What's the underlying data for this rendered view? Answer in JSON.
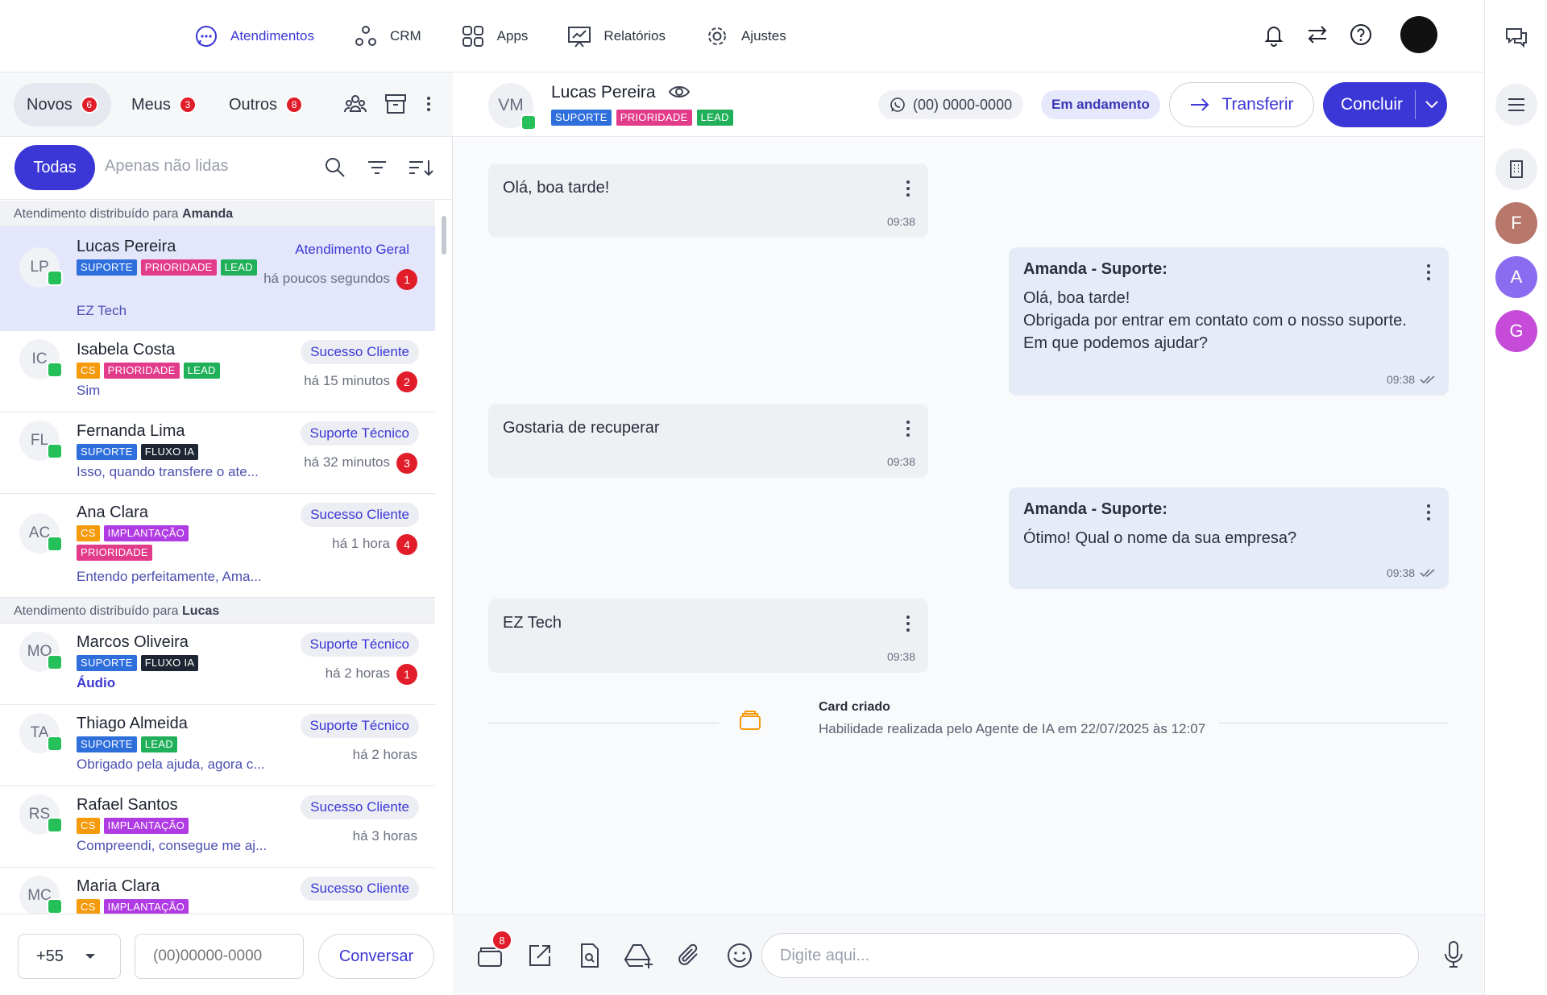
{
  "nav": {
    "items": [
      {
        "label": "Atendimentos",
        "icon": "chat-bubble-icon",
        "active": true
      },
      {
        "label": "CRM",
        "icon": "crm-nodes-icon",
        "active": false
      },
      {
        "label": "Apps",
        "icon": "apps-grid-icon",
        "active": false
      },
      {
        "label": "Relatórios",
        "icon": "presentation-chart-icon",
        "active": false
      },
      {
        "label": "Ajustes",
        "icon": "gear-icon",
        "active": false
      }
    ]
  },
  "left": {
    "tabs": [
      {
        "label": "Novos",
        "count": "6"
      },
      {
        "label": "Meus",
        "count": "3"
      },
      {
        "label": "Outros",
        "count": "8"
      }
    ],
    "filter_all": "Todas",
    "filter_unread": "Apenas não lidas",
    "sections": [
      {
        "prefix": "Atendimento distribuído para",
        "agent": "Amanda"
      },
      {
        "prefix": "Atendimento distribuído para",
        "agent": "Lucas"
      }
    ],
    "conversations": [
      {
        "initials": "LP",
        "name": "Lucas Pereira",
        "tags": [
          "SUPORTE",
          "PRIORIDADE",
          "LEAD"
        ],
        "preview": "EZ Tech",
        "dept": "Atendimento Geral",
        "time": "há poucos segundos",
        "count": "1"
      },
      {
        "initials": "IC",
        "name": "Isabela Costa",
        "tags": [
          "CS",
          "PRIORIDADE",
          "LEAD"
        ],
        "preview": "Sim",
        "dept": "Sucesso Cliente",
        "time": "há 15 minutos",
        "count": "2"
      },
      {
        "initials": "FL",
        "name": "Fernanda Lima",
        "tags": [
          "SUPORTE",
          "FLUXO IA"
        ],
        "preview": "Isso, quando transfere o ate...",
        "dept": "Suporte Técnico",
        "time": "há 32 minutos",
        "count": "3"
      },
      {
        "initials": "AC",
        "name": "Ana Clara",
        "tags": [
          "CS",
          "IMPLANTAÇÃO",
          "PRIORIDADE"
        ],
        "preview": "Entendo perfeitamente, Ama...",
        "dept": "Sucesso Cliente",
        "time": "há 1 hora",
        "count": "4"
      },
      {
        "initials": "MO",
        "name": "Marcos Oliveira",
        "tags": [
          "SUPORTE",
          "FLUXO IA"
        ],
        "preview": "Áudio",
        "dept": "Suporte Técnico",
        "time": "há 2 horas",
        "count": "1"
      },
      {
        "initials": "TA",
        "name": "Thiago Almeida",
        "tags": [
          "SUPORTE",
          "LEAD"
        ],
        "preview": "Obrigado pela ajuda, agora c...",
        "dept": "Suporte Técnico",
        "time": "há 2 horas",
        "count": ""
      },
      {
        "initials": "RS",
        "name": "Rafael Santos",
        "tags": [
          "CS",
          "IMPLANTAÇÃO"
        ],
        "preview": "Compreendi, consegue me aj...",
        "dept": "Sucesso Cliente",
        "time": "há 3 horas",
        "count": ""
      },
      {
        "initials": "MC",
        "name": "Maria Clara",
        "tags": [
          "CS",
          "IMPLANTAÇÃO"
        ],
        "preview": "",
        "dept": "Sucesso Cliente",
        "time": "",
        "count": ""
      }
    ],
    "footer": {
      "country_code": "+55",
      "phone_placeholder": "(00)00000-0000",
      "start_button": "Conversar"
    }
  },
  "chat": {
    "contact_initials": "VM",
    "contact_name": "Lucas Pereira",
    "tags": [
      "SUPORTE",
      "PRIORIDADE",
      "LEAD"
    ],
    "phone": "(00) 0000-0000",
    "status": "Em andamento",
    "transfer_label": "Transferir",
    "conclude_label": "Concluir",
    "messages": [
      {
        "dir": "in",
        "sender": "",
        "text": "Olá, boa tarde!",
        "time": "09:38"
      },
      {
        "dir": "out",
        "sender": "Amanda - Suporte:",
        "lines": [
          "Olá, boa tarde!",
          "Obrigada por entrar em contato com o nosso suporte.",
          "Em que podemos ajudar?"
        ],
        "time": "09:38"
      },
      {
        "dir": "in",
        "sender": "",
        "text": "Gostaria de recuperar",
        "time": "09:38"
      },
      {
        "dir": "out",
        "sender": "Amanda - Suporte:",
        "lines": [
          "Ótimo! Qual o nome da sua empresa?"
        ],
        "time": "09:38"
      },
      {
        "dir": "in",
        "sender": "",
        "text": "EZ Tech",
        "time": "09:38"
      }
    ],
    "system_event": {
      "title": "Card criado",
      "subtitle": "Habilidade realizada pelo Agente de IA em 22/07/2025 às 12:07"
    },
    "composer": {
      "placeholder": "Digite aqui...",
      "cards_badge": "8"
    }
  },
  "rail": {
    "avatars": [
      {
        "letter": "F",
        "color": "#b7776b"
      },
      {
        "letter": "A",
        "color": "#8a6cf0"
      },
      {
        "letter": "G",
        "color": "#c54bd8"
      }
    ]
  },
  "colors": {
    "accent": "#3b37d6",
    "badge": "#e11d2a",
    "whatsapp": "#25c05a"
  }
}
